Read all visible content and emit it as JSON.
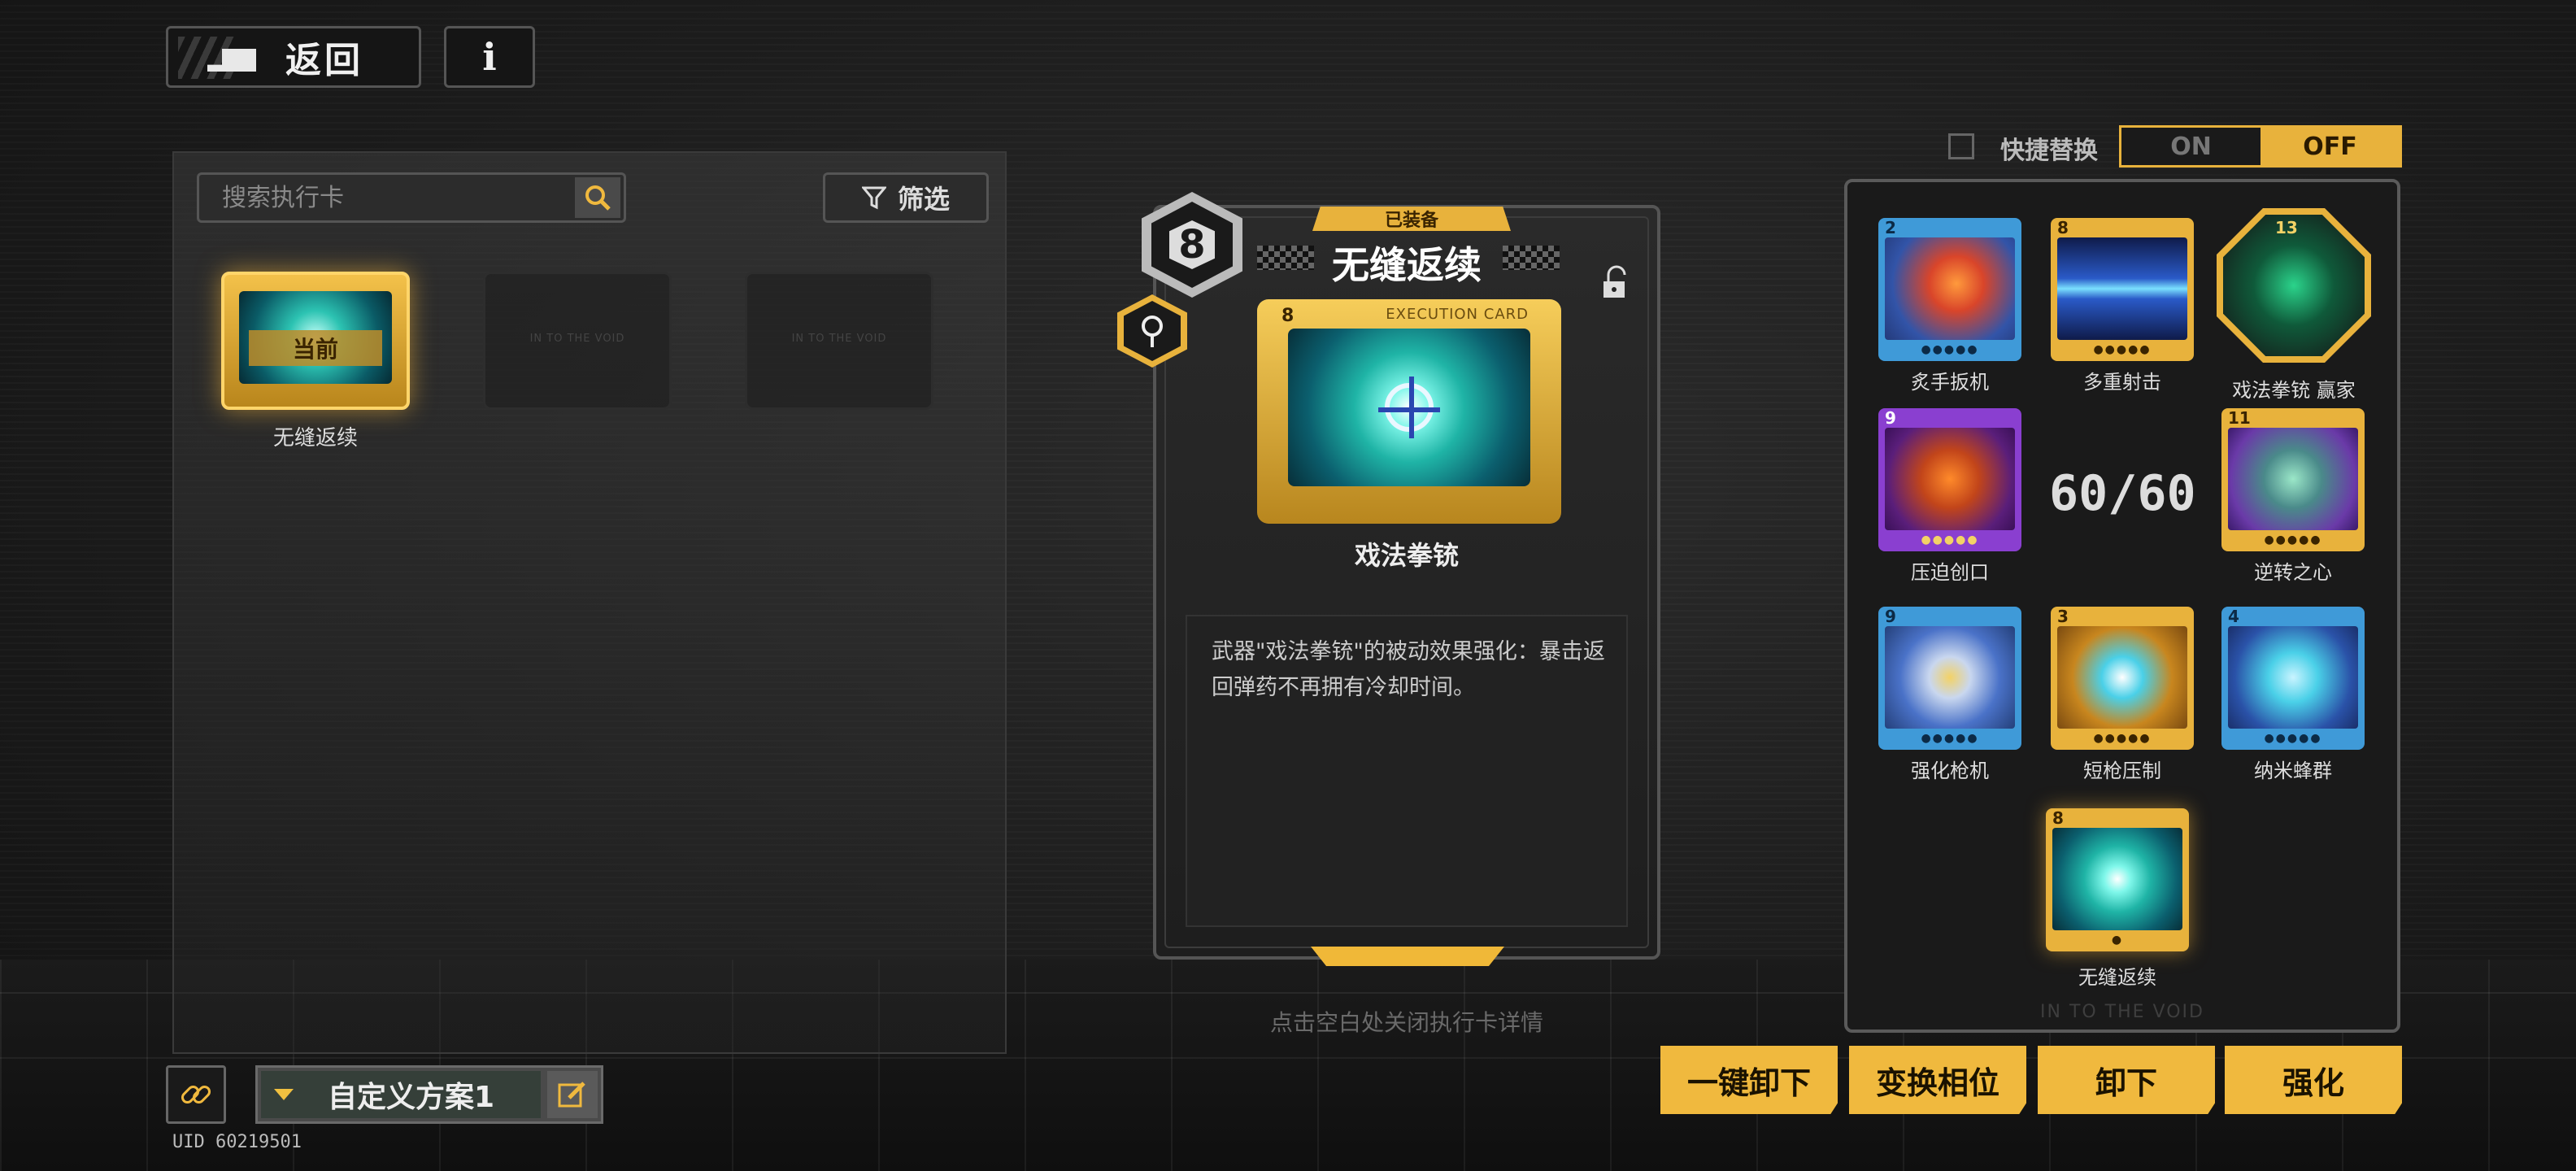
{
  "top": {
    "back_label": "返回",
    "info_label": "i"
  },
  "search": {
    "placeholder": "搜索执行卡"
  },
  "filter": {
    "label": "筛选"
  },
  "inventory": [
    {
      "state": "current",
      "tag": "当前",
      "name": "无缝返续"
    },
    {
      "state": "empty",
      "text": "IN TO THE VOID"
    },
    {
      "state": "empty",
      "text": "IN TO THE VOID"
    }
  ],
  "preset": {
    "name": "自定义方案1"
  },
  "uid": "UID 60219501",
  "detail": {
    "equipped_tag": "已装备",
    "cost": "8",
    "title": "无缝返续",
    "card_cost": "8",
    "card_label": "EXECUTION CARD",
    "weapon": "戏法拳铳",
    "description": "武器\"戏法拳铳\"的被动效果强化：暴击返回弹药不再拥有冷却时间。",
    "close_hint": "点击空白处关闭执行卡详情"
  },
  "quick_swap": {
    "label": "快捷替换",
    "on": "ON",
    "off": "OFF",
    "selected": "OFF"
  },
  "deck": {
    "count": "60/60",
    "footer": "IN TO THE VOID",
    "cards": [
      {
        "name": "炙手扳机",
        "cost": "2",
        "color": "blue"
      },
      {
        "name": "多重射击",
        "cost": "8",
        "color": "gold"
      },
      {
        "name": "戏法拳铳 赢家",
        "cost": "13",
        "color": "hex"
      },
      {
        "name": "压迫创口",
        "cost": "9",
        "color": "purple"
      },
      {
        "name": "逆转之心",
        "cost": "11",
        "color": "gold"
      },
      {
        "name": "强化枪机",
        "cost": "9",
        "color": "blue"
      },
      {
        "name": "短枪压制",
        "cost": "3",
        "color": "gold"
      },
      {
        "name": "纳米蜂群",
        "cost": "4",
        "color": "blue"
      },
      {
        "name": "无缝返续",
        "cost": "8",
        "color": "gold"
      }
    ]
  },
  "actions": {
    "unequip_all": "一键卸下",
    "swap_position": "变换相位",
    "unequip": "卸下",
    "enhance": "强化"
  },
  "colors": {
    "accent": "#e8b23c",
    "background": "#1c1c1c"
  }
}
